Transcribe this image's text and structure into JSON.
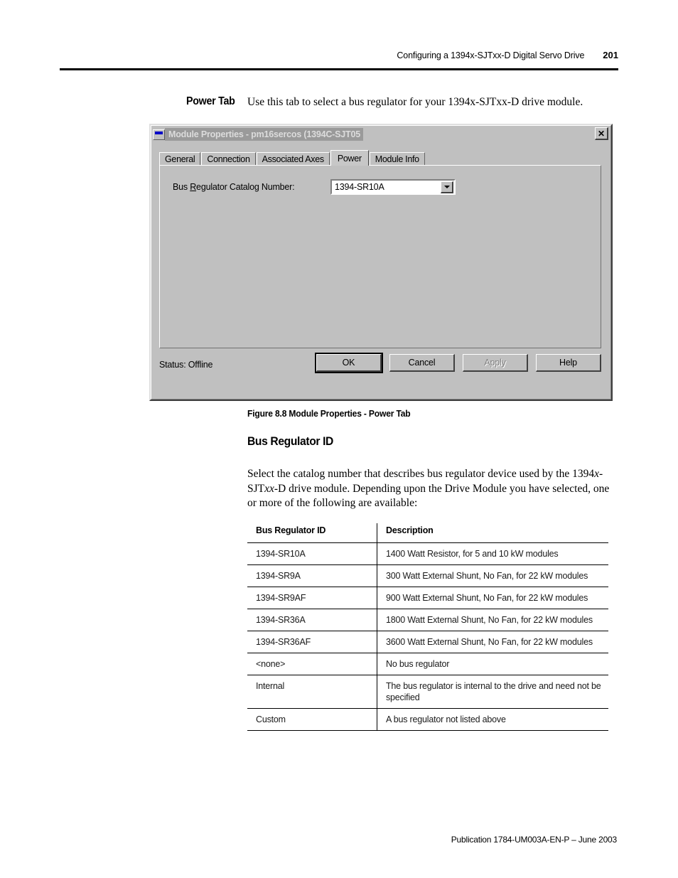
{
  "header": {
    "title": "Configuring a 1394x-SJTxx-D Digital Servo Drive",
    "page_number": "201"
  },
  "section": {
    "label": "Power Tab",
    "intro": "Use this tab to select a bus regulator for your 1394x-SJTxx-D drive module."
  },
  "dialog": {
    "title": "Module Properties - pm16sercos (1394C-SJT05",
    "close_label": "✕",
    "tabs": [
      {
        "label": "General",
        "selected": false
      },
      {
        "label": "Connection",
        "selected": false
      },
      {
        "label": "Associated Axes",
        "selected": false
      },
      {
        "label": "Power",
        "selected": true
      },
      {
        "label": "Module Info",
        "selected": false
      }
    ],
    "field": {
      "label_pre": "Bus ",
      "label_mnemonic1": "R",
      "label_mid": "e",
      "label_mnemonic2": "g",
      "label_post": "ulator Catalog Number:",
      "label_full": "Bus Regulator Catalog Number:",
      "value": "1394-SR10A",
      "arrow_icon": "chevron-down-icon"
    },
    "status": "Status:  Offline",
    "buttons": {
      "ok": "OK",
      "cancel": "Cancel",
      "apply": "Apply",
      "help": "Help"
    }
  },
  "figure": {
    "caption": "Figure 8.8 Module Properties - Power Tab"
  },
  "subheading": "Bus Regulator ID",
  "body_paragraph": {
    "line1": "Select the catalog number that describes bus regulator device used by the",
    "line2_a": "1394",
    "line2_x": "x",
    "line2_b": "-SJT",
    "line2_xx": "xx",
    "line2_c": "-D drive module. Depending upon the Drive Module you have",
    "line3": "selected, one or more of the following are available:"
  },
  "table": {
    "headers": [
      "Bus Regulator ID",
      "Description"
    ],
    "rows": [
      [
        "1394-SR10A",
        "1400 Watt Resistor, for 5 and 10 kW modules"
      ],
      [
        "1394-SR9A",
        "300 Watt External Shunt, No Fan, for 22 kW modules"
      ],
      [
        "1394-SR9AF",
        "900 Watt External Shunt, No Fan, for 22 kW modules"
      ],
      [
        "1394-SR36A",
        "1800 Watt External Shunt, No Fan, for 22 kW modules"
      ],
      [
        "1394-SR36AF",
        "3600 Watt External Shunt, No Fan, for 22 kW modules"
      ],
      [
        "<none>",
        "No bus regulator"
      ],
      [
        "Internal",
        "The bus regulator is internal to the drive and need not be specified"
      ],
      [
        "Custom",
        "A bus regulator not listed above"
      ]
    ]
  },
  "footer": "Publication 1784-UM003A-EN-P – June 2003"
}
